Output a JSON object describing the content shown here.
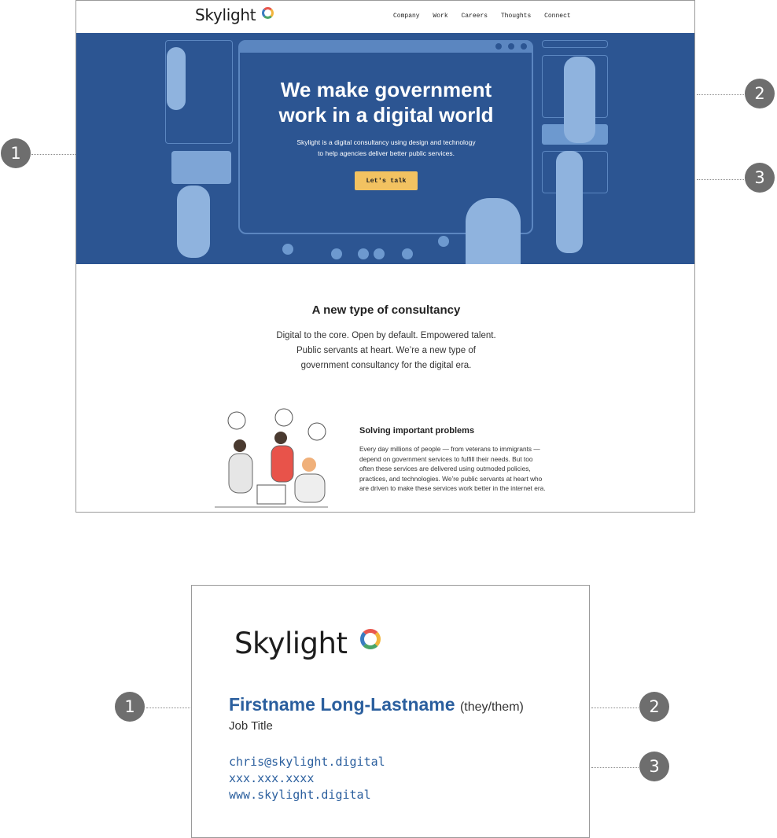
{
  "website": {
    "logo": "Skylight",
    "nav_links": [
      "Company",
      "Work",
      "Careers",
      "Thoughts",
      "Connect"
    ],
    "hero": {
      "title_line1": "We make government",
      "title_line2": "work in a digital world",
      "subtitle_line1": "Skylight is a digital consultancy using design and technology",
      "subtitle_line2": "to help agencies deliver better public services.",
      "cta_label": "Let's talk"
    },
    "section": {
      "title": "A new type of consultancy",
      "body_line1": "Digital to the core. Open by default. Empowered talent.",
      "body_line2": "Public servants at heart. We’re a new type of",
      "body_line3": "government consultancy for the digital era."
    },
    "problems": {
      "title": "Solving important problems",
      "body_lines": [
        "Every day millions of people — from veterans to immigrants —",
        "depend on government services to fulfill their needs. But too",
        "often these services are delivered using outmoded policies,",
        "practices, and technologies. We’re public servants at heart who",
        "are driven to make these services work better in the internet era."
      ]
    }
  },
  "callouts": {
    "top": [
      "1",
      "2",
      "3"
    ],
    "bottom": [
      "1",
      "2",
      "3"
    ]
  },
  "signature_card": {
    "logo": "Skylight",
    "name": "Firstname Long-Lastname",
    "pronouns": "(they/them)",
    "job_title": "Job Title",
    "email": "chris@skylight.digital",
    "phone": "xxx.xxx.xxxx",
    "website": "www.skylight.digital"
  },
  "colors": {
    "hero_blue": "#2c5592",
    "accent_blue": "#2b5f9e",
    "cta_yellow": "#f2c261",
    "badge_gray": "#6e6e6e"
  }
}
